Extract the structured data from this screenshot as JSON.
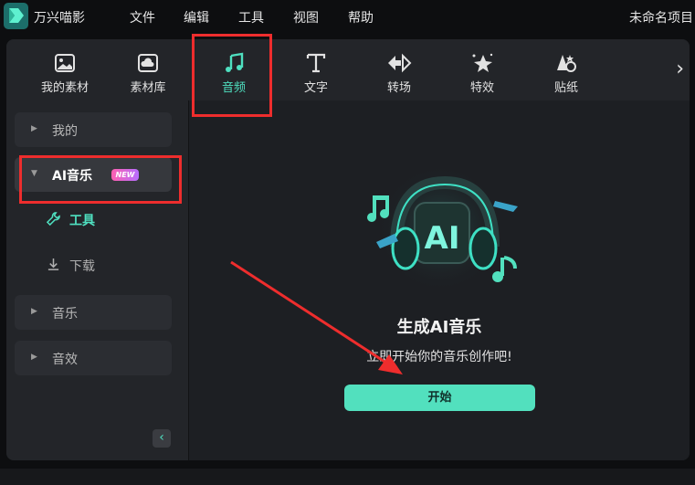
{
  "app": {
    "name": "万兴喵影",
    "project_name": "未命名项目"
  },
  "menu": [
    "文件",
    "编辑",
    "工具",
    "视图",
    "帮助"
  ],
  "tabs": [
    {
      "label": "我的素材",
      "icon": "image-icon"
    },
    {
      "label": "素材库",
      "icon": "cloud-icon"
    },
    {
      "label": "音频",
      "icon": "music-note-icon",
      "active": true
    },
    {
      "label": "文字",
      "icon": "text-icon"
    },
    {
      "label": "转场",
      "icon": "transition-icon"
    },
    {
      "label": "特效",
      "icon": "sparkle-star-icon"
    },
    {
      "label": "贴纸",
      "icon": "sticker-icon"
    }
  ],
  "sidebar": {
    "mine": "我的",
    "ai_music": "AI音乐",
    "new_badge": "NEW",
    "tools": "工具",
    "download": "下载",
    "music": "音乐",
    "sound_effects": "音效"
  },
  "content": {
    "hero_text": "AI",
    "title": "生成AI音乐",
    "subtitle": "立即开始你的音乐创作吧!",
    "start_button": "开始"
  },
  "colors": {
    "accent": "#4fe0c0",
    "button": "#52e0be",
    "highlight": "#ee2d2d"
  }
}
